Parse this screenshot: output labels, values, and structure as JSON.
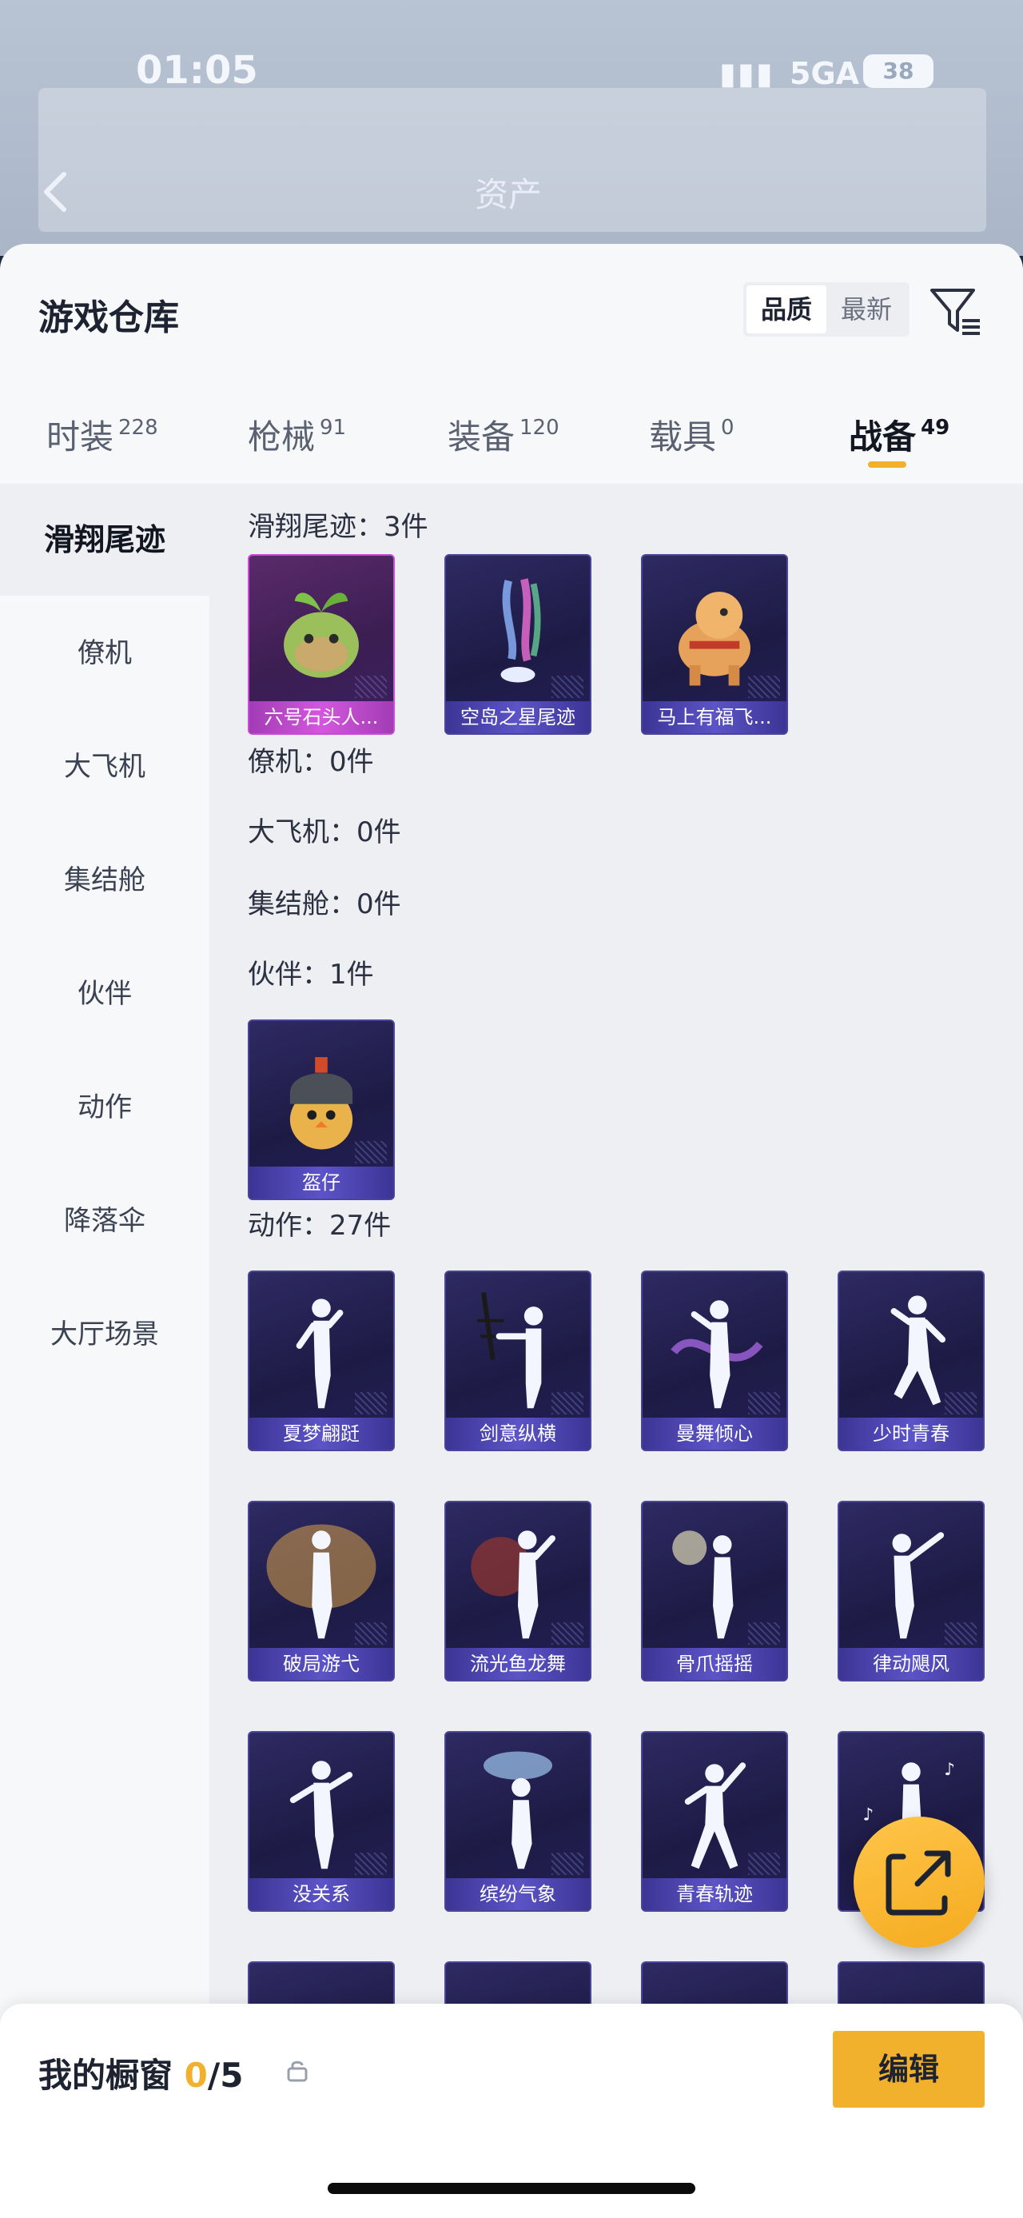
{
  "status_bar": {
    "time": "01:05",
    "network": "5GA",
    "battery": "38"
  },
  "nav": {
    "title": "资产"
  },
  "warehouse": {
    "title": "游戏仓库",
    "sort_options": [
      "品质",
      "最新"
    ],
    "tabs": [
      {
        "label": "时装",
        "count": "228"
      },
      {
        "label": "枪械",
        "count": "91"
      },
      {
        "label": "装备",
        "count": "120"
      },
      {
        "label": "载具",
        "count": "0"
      },
      {
        "label": "战备",
        "count": "49"
      }
    ],
    "active_tab": "战备"
  },
  "sidebar": {
    "items": [
      "滑翔尾迹",
      "僚机",
      "大飞机",
      "集结舱",
      "伙伴",
      "动作",
      "降落伞",
      "大厅场景"
    ]
  },
  "sections": {
    "trail": {
      "title": "滑翔尾迹：3件",
      "items": [
        "六号石头人...",
        "空岛之星尾迹",
        "马上有福飞..."
      ]
    },
    "wingman": {
      "title": "僚机：0件"
    },
    "plane": {
      "title": "大飞机：0件"
    },
    "pod": {
      "title": "集结舱：0件"
    },
    "partner": {
      "title": "伙伴：1件",
      "items": [
        "盔仔"
      ]
    },
    "emote": {
      "title": "动作：27件",
      "items": [
        "夏梦翩跹",
        "剑意纵横",
        "曼舞倾心",
        "少时青春",
        "破局游弋",
        "流光鱼龙舞",
        "骨爪摇摇",
        "律动飓风",
        "没关系",
        "缤纷气象",
        "青春轨迹"
      ]
    }
  },
  "bottom": {
    "showcase_label": "我的橱窗",
    "showcase_used": "0",
    "showcase_total": "/5",
    "edit_label": "编辑"
  },
  "colors": {
    "accent": "#f2b12d",
    "card_bg": "#241f57",
    "card_purple": "#5c54c7",
    "card_pink": "#d357dd"
  },
  "icons": {
    "back": "chevron-left-icon",
    "filter": "filter-icon",
    "lock": "lock-icon",
    "share": "share-icon"
  }
}
